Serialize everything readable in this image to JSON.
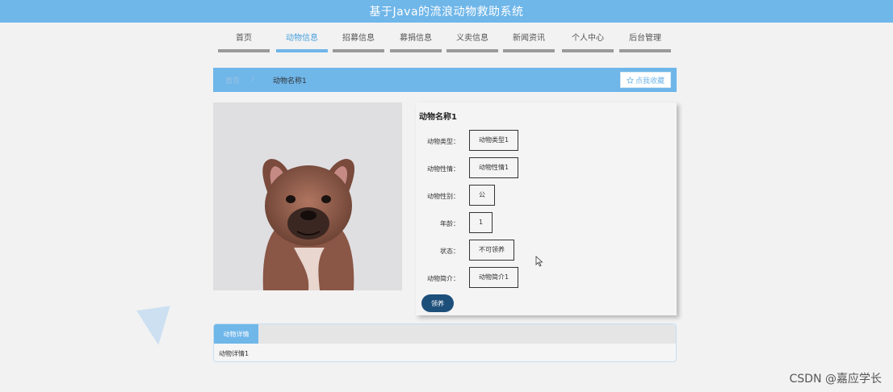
{
  "header": {
    "title": "基于Java的流浪动物救助系统"
  },
  "nav": {
    "items": [
      {
        "label": "首页",
        "active": false
      },
      {
        "label": "动物信息",
        "active": true
      },
      {
        "label": "招募信息",
        "active": false
      },
      {
        "label": "募捐信息",
        "active": false
      },
      {
        "label": "义卖信息",
        "active": false
      },
      {
        "label": "新闻资讯",
        "active": false
      },
      {
        "label": "个人中心",
        "active": false
      },
      {
        "label": "后台管理",
        "active": false
      }
    ]
  },
  "breadcrumb": {
    "home": "首页",
    "separator": "/",
    "current": "动物名称1",
    "favorite_label": "点我收藏"
  },
  "detail": {
    "name": "动物名称1",
    "fields": [
      {
        "label": "动物类型：",
        "value": "动物类型1"
      },
      {
        "label": "动物性情：",
        "value": "动物性情1"
      },
      {
        "label": "动物性别：",
        "value": "公"
      },
      {
        "label": "年龄：",
        "value": "1"
      },
      {
        "label": "状态：",
        "value": "不可领养"
      },
      {
        "label": "动物简介：",
        "value": "动物简介1"
      }
    ],
    "adopt_label": "领养"
  },
  "tabs": {
    "active_label": "动物详情",
    "content": "动物详情1"
  },
  "watermark": "CSDN @嘉应学长",
  "colors": {
    "primary": "#6fb6e9",
    "button_dark": "#1d4f7b",
    "background": "#f2f2f2"
  }
}
